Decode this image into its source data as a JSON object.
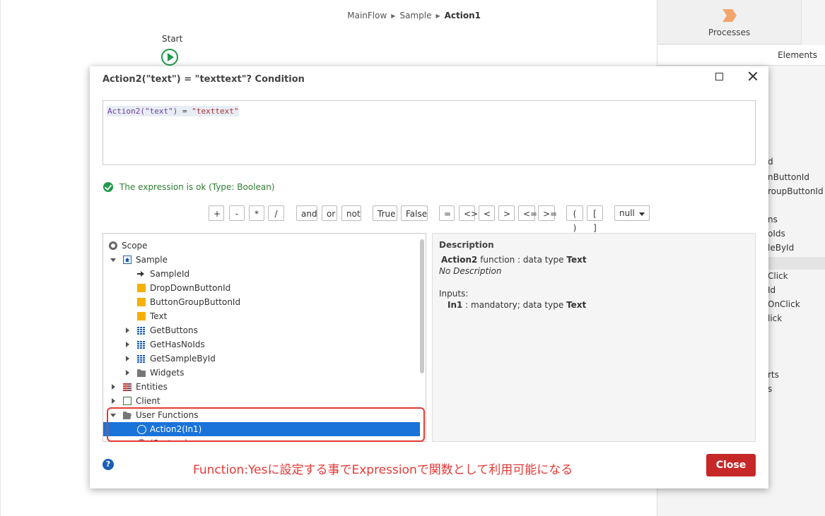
{
  "breadcrumb": [
    "MainFlow",
    "Sample",
    "Action1"
  ],
  "canvas": {
    "start_label": "Start"
  },
  "right_panel": {
    "processes_label": "Processes",
    "elements_label": "Elements",
    "partial_items": [
      "d",
      "nButtonId",
      "roupButtonId",
      "ns",
      "oIds",
      "leById",
      "Click",
      "Id",
      "OnClick",
      "lick",
      "rts",
      "s"
    ]
  },
  "modal": {
    "title": "Action2(\"text\") = \"texttext\"? Condition",
    "expression": {
      "fn": "Action2(\"text\")",
      "op": " = ",
      "str": "\"texttext\""
    },
    "status_text": "The expression is ok (Type: Boolean)",
    "operators": [
      "+",
      "-",
      "*",
      "/",
      "and",
      "or",
      "not",
      "True",
      "False",
      "=",
      "<>",
      "<",
      ">",
      "<=",
      ">=",
      "( )",
      "[ ]"
    ],
    "null_select": "null",
    "tree": [
      {
        "label": "Scope"
      },
      {
        "label": "Sample"
      },
      {
        "label": "SampleId"
      },
      {
        "label": "DropDownButtonId"
      },
      {
        "label": "ButtonGroupButtonId"
      },
      {
        "label": "Text"
      },
      {
        "label": "GetButtons"
      },
      {
        "label": "GetHasNoIds"
      },
      {
        "label": "GetSampleById"
      },
      {
        "label": "Widgets"
      },
      {
        "label": "Entities"
      },
      {
        "label": "Client"
      },
      {
        "label": "User Functions"
      },
      {
        "label": "Action2(In1)"
      },
      {
        "label": "(System)"
      }
    ],
    "description": {
      "title": "Description",
      "fn_name": "Action2",
      "fn_text": " function : data type ",
      "fn_type": "Text",
      "no_desc": "No Description",
      "inputs_label": "Inputs:",
      "input_name": "In1",
      "input_text": " : mandatory; data type ",
      "input_type": "Text"
    },
    "help": "?",
    "annotation": "Function:Yesに設定する事でExpressionで関数として利用可能になる",
    "close_label": "Close"
  }
}
